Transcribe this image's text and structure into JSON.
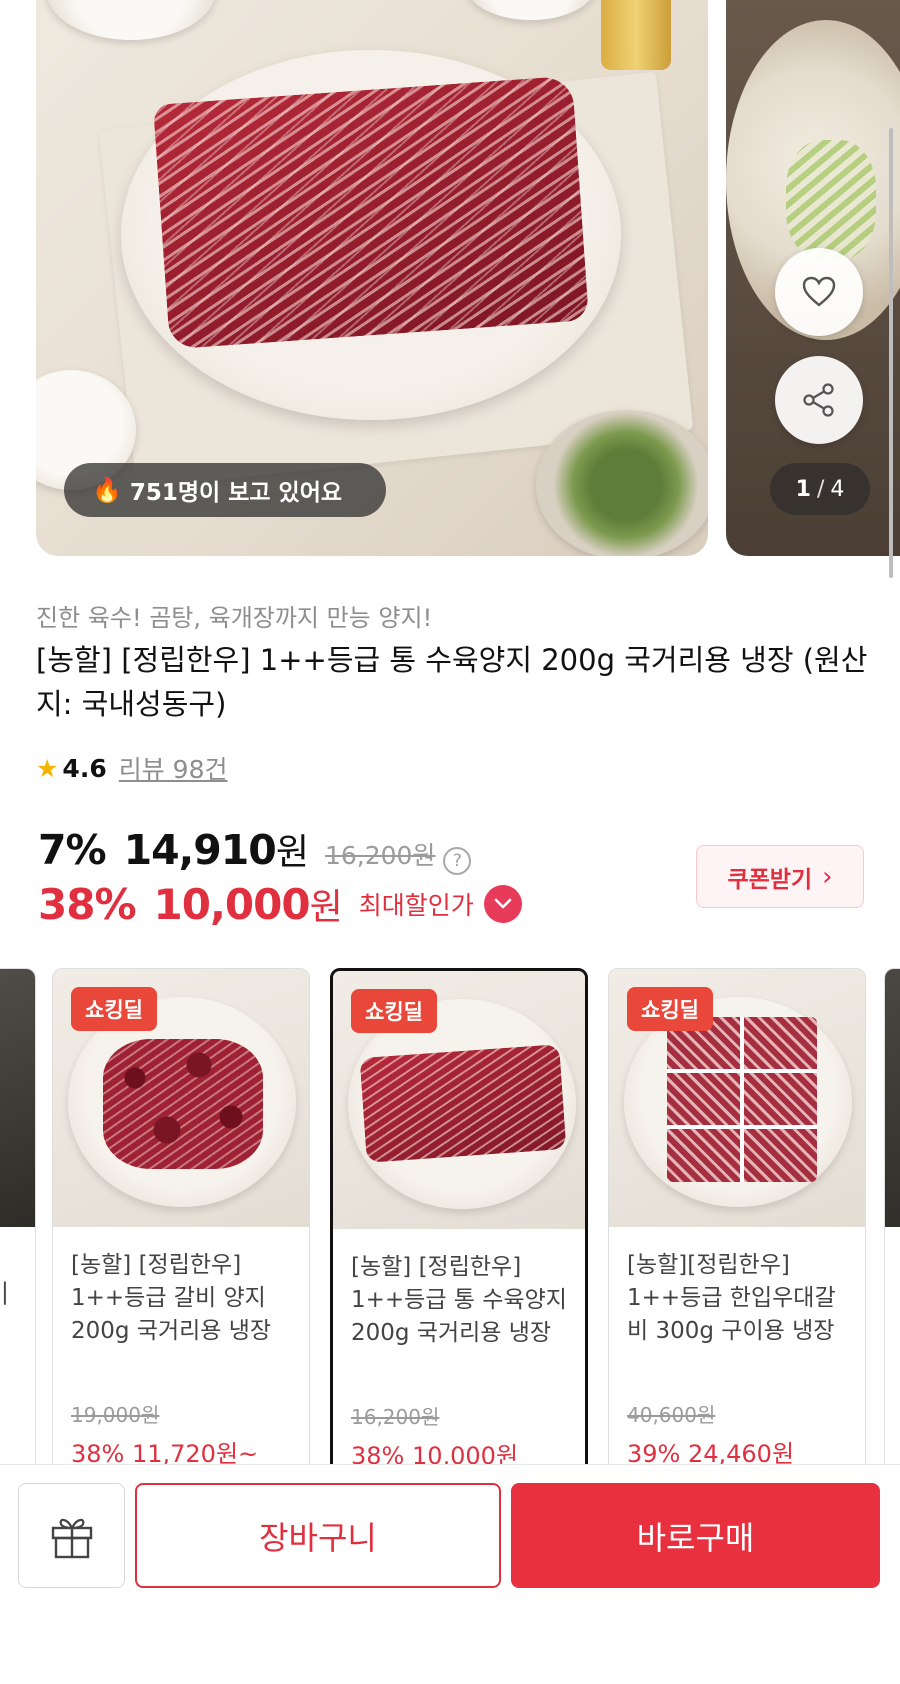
{
  "hero": {
    "viewers_text": "751명이 보고 있어요",
    "page_current": "1",
    "page_separator": "/",
    "page_total": "4"
  },
  "product": {
    "subtitle": "진한 육수! 곰탕, 육개장까지 만능 양지!",
    "title": "[농할] [정립한우] 1++등급 통 수육양지 200g 국거리용 냉장 (원산지: 국내성동구)",
    "rating": "4.6",
    "reviews_label": "리뷰 98건"
  },
  "pricing": {
    "discount_pct": "7%",
    "price": "14,910",
    "won": "원",
    "original_price": "16,200원",
    "max_discount_pct": "38%",
    "max_price": "10,000",
    "max_label": "최대할인가",
    "coupon_label": "쿠폰받기"
  },
  "cards": {
    "partial_left_fragment": "|",
    "items": [
      {
        "badge": "쇼킹딜",
        "name": "[농할] [정립한우] 1++등급 갈비 양지 200g 국거리용 냉장",
        "original_price": "19,000원",
        "sale": "38% 11,720원~"
      },
      {
        "badge": "쇼킹딜",
        "name": "[농할] [정립한우] 1++등급 통 수육양지 200g 국거리용 냉장",
        "original_price": "16,200원",
        "sale": "38% 10,000원"
      },
      {
        "badge": "쇼킹딜",
        "name": "[농할][정립한우] 1++등급 한입우대갈비 300g 구이용 냉장",
        "original_price": "40,600원",
        "sale": "39% 24,460원"
      }
    ]
  },
  "actions": {
    "cart_label": "장바구니",
    "buy_label": "바로구매"
  },
  "colors": {
    "accent_red": "#e0303f",
    "badge_orange": "#e8473a",
    "star_yellow": "#f3b300"
  }
}
